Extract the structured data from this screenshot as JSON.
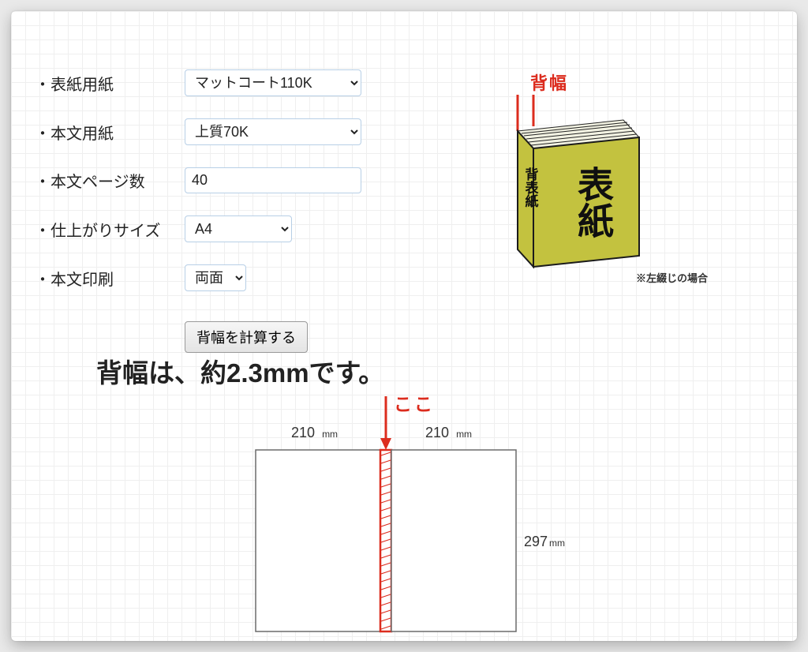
{
  "form": {
    "cover_paper": {
      "label": "・表紙用紙",
      "value": "マットコート110K"
    },
    "body_paper": {
      "label": "・本文用紙",
      "value": "上質70K"
    },
    "pages": {
      "label": "・本文ページ数",
      "value": "40"
    },
    "size": {
      "label": "・仕上がりサイズ",
      "value": "A4"
    },
    "duplex": {
      "label": "・本文印刷",
      "value": "両面"
    },
    "calc_label": "背幅を計算する"
  },
  "result": {
    "headline": "背幅は、約2.3mmです。",
    "spine_mm": 2.3
  },
  "illus_3d": {
    "spine_title": "背幅",
    "front_cover": "表紙",
    "spine_cover": "背表紙",
    "caption": "※左綴じの場合"
  },
  "spread": {
    "koko": "ここ",
    "w1": "210",
    "w2": "210",
    "w_unit": "mm",
    "h": "297",
    "h_unit": "mm"
  }
}
